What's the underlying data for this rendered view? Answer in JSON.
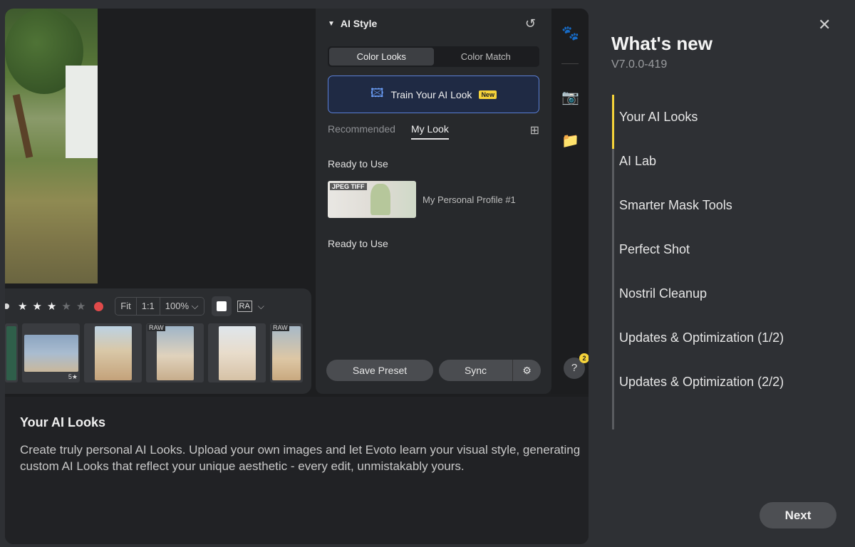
{
  "screenshot": {
    "ai_panel": {
      "header": "AI Style",
      "segments": [
        "Color Looks",
        "Color Match"
      ],
      "active_segment": "Color Looks",
      "train_button": {
        "label": "Train Your AI Look",
        "badge": "New"
      },
      "subtabs": [
        "Recommended",
        "My Look"
      ],
      "active_subtab": "My Look",
      "section1": "Ready to Use",
      "profile": {
        "tag": "JPEG TIFF",
        "name": "My Personal Profile #1"
      },
      "section2": "Ready to Use",
      "save_preset": "Save Preset",
      "sync": "Sync"
    },
    "filmstrip": {
      "zoom": [
        "Fit",
        "1:1",
        "100% ⌵"
      ],
      "thumb_tags": [
        "RAW",
        "RAW"
      ],
      "rating_label": "5★",
      "raw_toggle": "RA"
    },
    "help_badge": "2",
    "accent_color": "#f5d33a",
    "highlight_color": "#5a7fd6"
  },
  "description": {
    "title": "Your AI Looks",
    "body": "Create truly personal AI Looks. Upload your own images and let Evoto learn your visual style, generating custom AI Looks that reflect your unique aesthetic - every edit, unmistakably yours."
  },
  "sidebar": {
    "title": "What's new",
    "version": "V7.0.0-419",
    "items": [
      "Your AI Looks",
      "AI Lab",
      "Smarter Mask Tools",
      "Perfect Shot",
      "Nostril Cleanup",
      "Updates & Optimization (1/2)",
      "Updates & Optimization (2/2)"
    ],
    "active_index": 0,
    "next_label": "Next"
  }
}
